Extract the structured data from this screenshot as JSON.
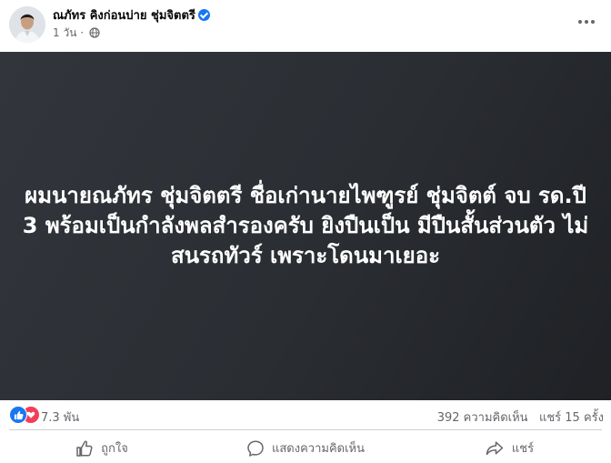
{
  "post": {
    "author_name": "ณภัทร คิงก่อนบ่าย ชุ่มจิตตรี",
    "time": "1 วัน",
    "separator": "·",
    "content_text": "ผมนายณภัทร ชุ่มจิตตรี ชื่อเก่านายไพฑูรย์ ชุ่มจิตต์ จบ รด.ปี 3 พร้อมเป็นกำลังพลสำรองครับ ยิงปืนเป็น มีปืนสั้นส่วนตัว ไม่สนรถทัวร์ เพราะโดนมาเยอะ"
  },
  "reactions": {
    "count": "7.3 พัน",
    "comments": "392 ความคิดเห็น",
    "shares": "แชร์ 15 ครั้ง"
  },
  "actions": {
    "like_label": "ถูกใจ",
    "comment_label": "แสดงความคิดเห็น",
    "share_label": "แชร์"
  },
  "colors": {
    "brand_blue": "#1877f2",
    "love_red": "#f33e58",
    "muted_text": "#65676b",
    "card_background": "#2d3035"
  }
}
